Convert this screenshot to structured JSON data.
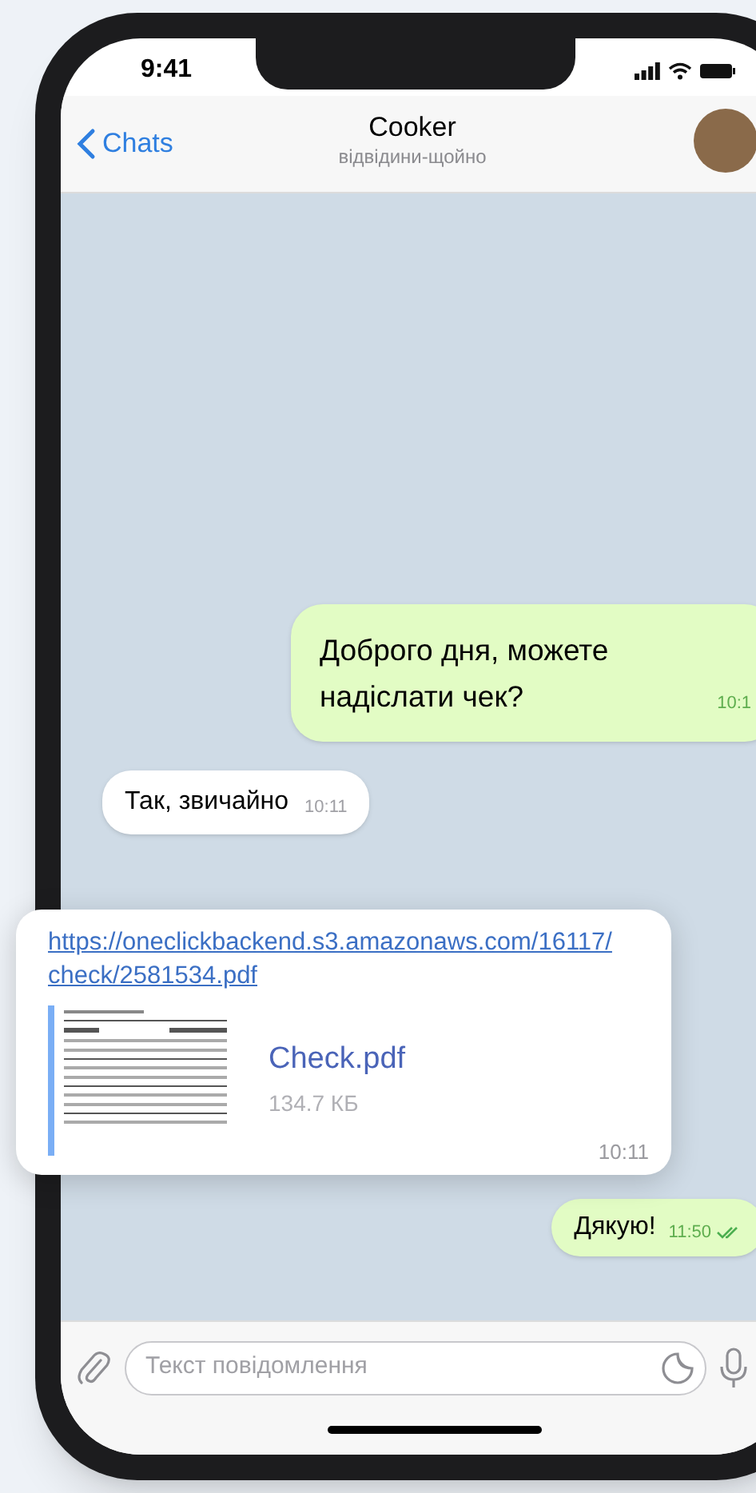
{
  "status_bar": {
    "time": "9:41"
  },
  "header": {
    "back": "Chats",
    "title": "Cooker",
    "subtitle": "відвідини-щойно"
  },
  "messages": [
    {
      "kind": "text",
      "outgoing": true,
      "text": "Доброго дня, можете надіслати чек?",
      "time": "10:1",
      "read": false
    },
    {
      "kind": "text",
      "outgoing": false,
      "text": "Так, звичайно",
      "time": "10:11"
    },
    {
      "kind": "file",
      "outgoing": false,
      "link": "https://oneclickbackend.s3.amazonaws.com/16117/check/2581534.pdf",
      "file_name": "Check.pdf",
      "file_size": "134.7 КБ",
      "time": "10:11"
    },
    {
      "kind": "text",
      "outgoing": true,
      "text": "Дякую!",
      "time": "11:50",
      "read": true
    }
  ],
  "composer": {
    "placeholder": "Текст повідомлення"
  }
}
